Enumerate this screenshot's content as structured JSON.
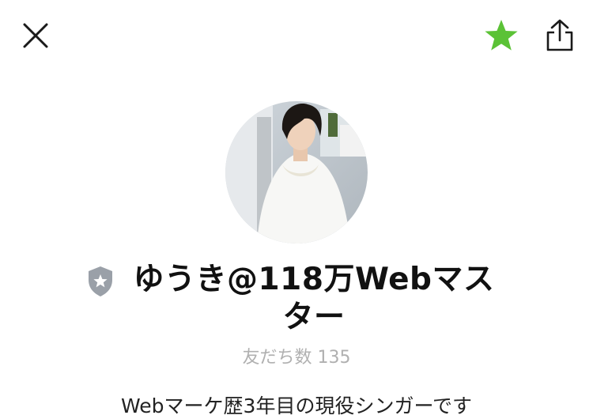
{
  "header": {
    "close_icon": "close-icon",
    "favorite_icon": "star-icon",
    "favorite_color": "#5bc236",
    "share_icon": "share-icon"
  },
  "profile": {
    "badge_icon": "verified-shield-icon",
    "name": "ゆうき@118万Webマスター",
    "friends_count_text": "友だち数 135",
    "status_message": "Webマーケ歴3年目の現役シンガーです"
  }
}
